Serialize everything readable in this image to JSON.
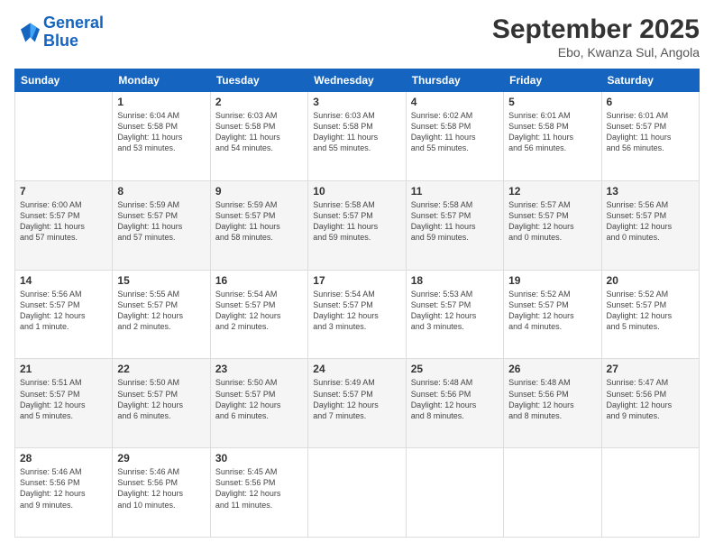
{
  "logo": {
    "line1": "General",
    "line2": "Blue"
  },
  "title": "September 2025",
  "subtitle": "Ebo, Kwanza Sul, Angola",
  "days_of_week": [
    "Sunday",
    "Monday",
    "Tuesday",
    "Wednesday",
    "Thursday",
    "Friday",
    "Saturday"
  ],
  "weeks": [
    [
      {
        "day": "",
        "details": ""
      },
      {
        "day": "1",
        "details": "Sunrise: 6:04 AM\nSunset: 5:58 PM\nDaylight: 11 hours\nand 53 minutes."
      },
      {
        "day": "2",
        "details": "Sunrise: 6:03 AM\nSunset: 5:58 PM\nDaylight: 11 hours\nand 54 minutes."
      },
      {
        "day": "3",
        "details": "Sunrise: 6:03 AM\nSunset: 5:58 PM\nDaylight: 11 hours\nand 55 minutes."
      },
      {
        "day": "4",
        "details": "Sunrise: 6:02 AM\nSunset: 5:58 PM\nDaylight: 11 hours\nand 55 minutes."
      },
      {
        "day": "5",
        "details": "Sunrise: 6:01 AM\nSunset: 5:58 PM\nDaylight: 11 hours\nand 56 minutes."
      },
      {
        "day": "6",
        "details": "Sunrise: 6:01 AM\nSunset: 5:57 PM\nDaylight: 11 hours\nand 56 minutes."
      }
    ],
    [
      {
        "day": "7",
        "details": "Sunrise: 6:00 AM\nSunset: 5:57 PM\nDaylight: 11 hours\nand 57 minutes."
      },
      {
        "day": "8",
        "details": "Sunrise: 5:59 AM\nSunset: 5:57 PM\nDaylight: 11 hours\nand 57 minutes."
      },
      {
        "day": "9",
        "details": "Sunrise: 5:59 AM\nSunset: 5:57 PM\nDaylight: 11 hours\nand 58 minutes."
      },
      {
        "day": "10",
        "details": "Sunrise: 5:58 AM\nSunset: 5:57 PM\nDaylight: 11 hours\nand 59 minutes."
      },
      {
        "day": "11",
        "details": "Sunrise: 5:58 AM\nSunset: 5:57 PM\nDaylight: 11 hours\nand 59 minutes."
      },
      {
        "day": "12",
        "details": "Sunrise: 5:57 AM\nSunset: 5:57 PM\nDaylight: 12 hours\nand 0 minutes."
      },
      {
        "day": "13",
        "details": "Sunrise: 5:56 AM\nSunset: 5:57 PM\nDaylight: 12 hours\nand 0 minutes."
      }
    ],
    [
      {
        "day": "14",
        "details": "Sunrise: 5:56 AM\nSunset: 5:57 PM\nDaylight: 12 hours\nand 1 minute."
      },
      {
        "day": "15",
        "details": "Sunrise: 5:55 AM\nSunset: 5:57 PM\nDaylight: 12 hours\nand 2 minutes."
      },
      {
        "day": "16",
        "details": "Sunrise: 5:54 AM\nSunset: 5:57 PM\nDaylight: 12 hours\nand 2 minutes."
      },
      {
        "day": "17",
        "details": "Sunrise: 5:54 AM\nSunset: 5:57 PM\nDaylight: 12 hours\nand 3 minutes."
      },
      {
        "day": "18",
        "details": "Sunrise: 5:53 AM\nSunset: 5:57 PM\nDaylight: 12 hours\nand 3 minutes."
      },
      {
        "day": "19",
        "details": "Sunrise: 5:52 AM\nSunset: 5:57 PM\nDaylight: 12 hours\nand 4 minutes."
      },
      {
        "day": "20",
        "details": "Sunrise: 5:52 AM\nSunset: 5:57 PM\nDaylight: 12 hours\nand 5 minutes."
      }
    ],
    [
      {
        "day": "21",
        "details": "Sunrise: 5:51 AM\nSunset: 5:57 PM\nDaylight: 12 hours\nand 5 minutes."
      },
      {
        "day": "22",
        "details": "Sunrise: 5:50 AM\nSunset: 5:57 PM\nDaylight: 12 hours\nand 6 minutes."
      },
      {
        "day": "23",
        "details": "Sunrise: 5:50 AM\nSunset: 5:57 PM\nDaylight: 12 hours\nand 6 minutes."
      },
      {
        "day": "24",
        "details": "Sunrise: 5:49 AM\nSunset: 5:57 PM\nDaylight: 12 hours\nand 7 minutes."
      },
      {
        "day": "25",
        "details": "Sunrise: 5:48 AM\nSunset: 5:56 PM\nDaylight: 12 hours\nand 8 minutes."
      },
      {
        "day": "26",
        "details": "Sunrise: 5:48 AM\nSunset: 5:56 PM\nDaylight: 12 hours\nand 8 minutes."
      },
      {
        "day": "27",
        "details": "Sunrise: 5:47 AM\nSunset: 5:56 PM\nDaylight: 12 hours\nand 9 minutes."
      }
    ],
    [
      {
        "day": "28",
        "details": "Sunrise: 5:46 AM\nSunset: 5:56 PM\nDaylight: 12 hours\nand 9 minutes."
      },
      {
        "day": "29",
        "details": "Sunrise: 5:46 AM\nSunset: 5:56 PM\nDaylight: 12 hours\nand 10 minutes."
      },
      {
        "day": "30",
        "details": "Sunrise: 5:45 AM\nSunset: 5:56 PM\nDaylight: 12 hours\nand 11 minutes."
      },
      {
        "day": "",
        "details": ""
      },
      {
        "day": "",
        "details": ""
      },
      {
        "day": "",
        "details": ""
      },
      {
        "day": "",
        "details": ""
      }
    ]
  ]
}
